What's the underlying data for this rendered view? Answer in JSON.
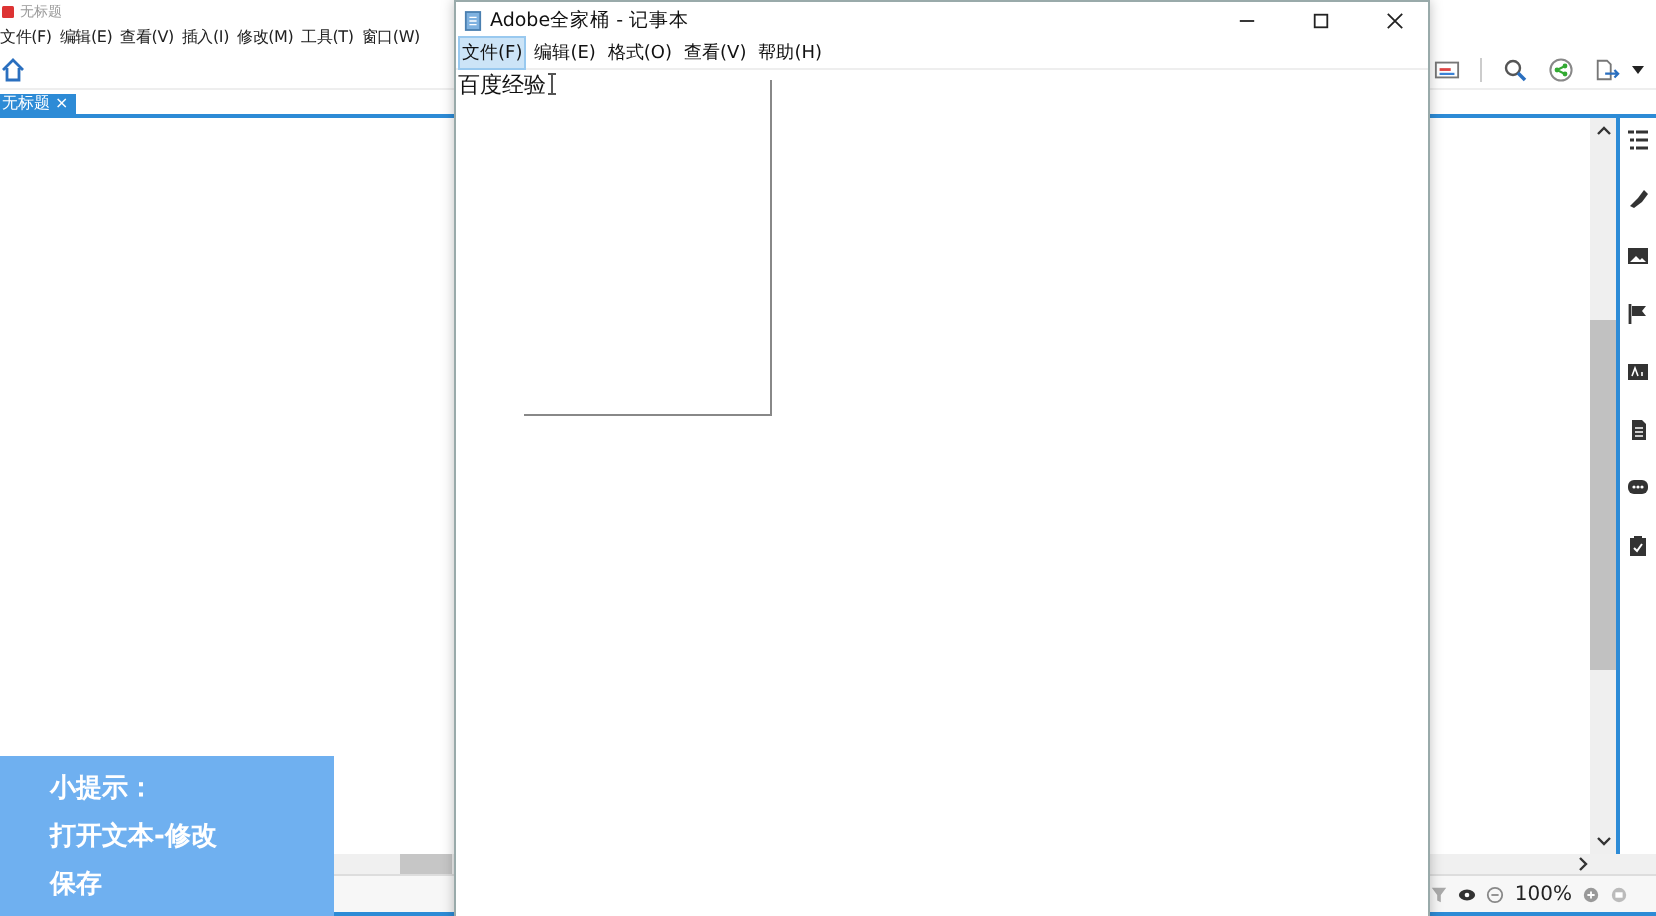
{
  "editor": {
    "title": "无标题",
    "menu": [
      "文件(F)",
      "编辑(E)",
      "查看(V)",
      "插入(I)",
      "修改(M)",
      "工具(T)",
      "窗口(W)"
    ],
    "document_tab": {
      "label": "无标题",
      "close": "×"
    },
    "zoom": "100%"
  },
  "notepad": {
    "title": "Adobe全家桶 - 记事本",
    "menu": [
      {
        "label": "文件(F)",
        "selected": true
      },
      {
        "label": "编辑(E)",
        "selected": false
      },
      {
        "label": "格式(O)",
        "selected": false
      },
      {
        "label": "查看(V)",
        "selected": false
      },
      {
        "label": "帮助(H)",
        "selected": false
      }
    ],
    "text": "百度经验"
  },
  "tip": {
    "lines": [
      "小提示：",
      "打开文本-修改",
      "保存"
    ]
  }
}
